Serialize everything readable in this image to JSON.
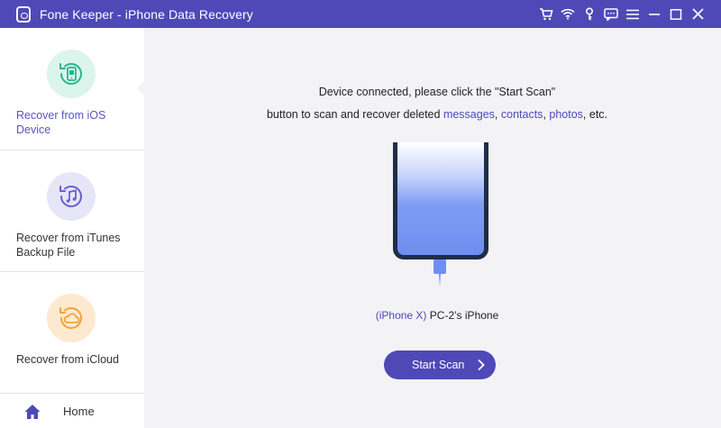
{
  "app": {
    "title": "Fone Keeper - iPhone Data Recovery"
  },
  "titlebar_icons": [
    "cart-icon",
    "wifi-icon",
    "key-icon",
    "chat-icon",
    "menu-icon",
    "minimize-icon",
    "maximize-icon",
    "close-icon"
  ],
  "sidebar": {
    "items": [
      {
        "label": "Recover from iOS Device",
        "icon": "phone-recover-icon",
        "active": true,
        "color": "#23b98a"
      },
      {
        "label": "Recover from iTunes Backup File",
        "icon": "music-recover-icon",
        "active": false,
        "color": "#6a5fd1"
      },
      {
        "label": "Recover from iCloud",
        "icon": "cloud-recover-icon",
        "active": false,
        "color": "#f0a33a"
      }
    ],
    "home_label": "Home"
  },
  "main": {
    "instruction_line1": "Device connected, please click the \"Start Scan\"",
    "instruction_line2_prefix": "button to scan and recover deleted ",
    "link_messages": "messages",
    "sep1": ", ",
    "link_contacts": "contacts",
    "sep2": ", ",
    "link_photos": "photos",
    "instruction_suffix": ", etc.",
    "device_model": "(iPhone X)",
    "device_owner": " PC-2’s iPhone",
    "start_button": "Start Scan"
  },
  "colors": {
    "accent": "#4f49b8",
    "sidebar_bg": "#ffffff",
    "main_bg": "#f3f3f6"
  }
}
